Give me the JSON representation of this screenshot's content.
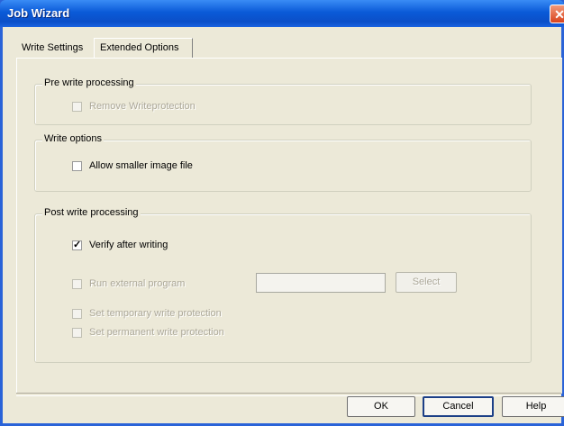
{
  "window": {
    "title": "Job Wizard",
    "close_label": "✕"
  },
  "tabs": [
    {
      "label": "Write Settings",
      "active": false
    },
    {
      "label": "Extended Options",
      "active": true
    }
  ],
  "pre_write": {
    "title": "Pre write processing",
    "remove_writeprotection": {
      "label": "Remove Writeprotection",
      "checked": false,
      "enabled": false
    }
  },
  "write_options": {
    "title": "Write options",
    "allow_smaller": {
      "label": "Allow smaller image file",
      "checked": false,
      "enabled": true
    }
  },
  "post_write": {
    "title": "Post write processing",
    "verify": {
      "label": "Verify after writing",
      "checked": true,
      "enabled": true
    },
    "run_external": {
      "label": "Run external program",
      "checked": false,
      "enabled": false
    },
    "program_path": {
      "value": "",
      "enabled": false
    },
    "select_label": "Select",
    "temp_protection": {
      "label": "Set temporary write protection",
      "checked": false,
      "enabled": false
    },
    "perm_protection": {
      "label": "Set permanent write protection",
      "checked": false,
      "enabled": false
    }
  },
  "footer": {
    "ok_label": "OK",
    "cancel_label": "Cancel",
    "help_label": "Help"
  },
  "colors": {
    "titlebar": "#0b4fc8",
    "dialog_face": "#ece9d8",
    "disabled_text": "#aca899"
  }
}
